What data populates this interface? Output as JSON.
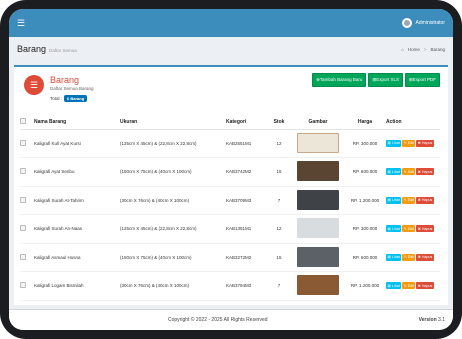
{
  "topbar": {
    "menu_icon": "☰",
    "user_name": "Administrator"
  },
  "header": {
    "title": "Barang",
    "subtitle": "Daftar Semua",
    "breadcrumb": {
      "home_icon": "⌂",
      "home": "Home",
      "sep": ">",
      "current": "Barang"
    }
  },
  "box": {
    "icon": "☰",
    "title": "Barang",
    "subtitle": "Daftar Semua Barang",
    "total_label": "Total :",
    "total_badge": "6 Barang",
    "buttons": {
      "add": "⊕Tambah Barang Baru",
      "export_xls": "⊞Export XLS",
      "export_pdf": "⊞Export PDF"
    }
  },
  "table": {
    "headers": {
      "nama": "Nama Barang",
      "ukuran": "Ukuran",
      "kategori": "Kategori",
      "stok": "Stok",
      "gambar": "Gambar",
      "harga": "Harga",
      "aksi": "Action"
    },
    "action_labels": {
      "lihat": "▤ Lihat",
      "edit": "✎ Edit",
      "hapus": "✖ Hapus"
    },
    "rows": [
      {
        "nama": "Kaligrafi Kufi Ayat Kursi",
        "ukuran": "(125cm X 45cm) & (22,8cm X 22,8cm)",
        "kategori": "KAB2551M1",
        "stok": "12",
        "harga": "RP. 300.000"
      },
      {
        "nama": "Kaligrafi Ayat Seribu",
        "ukuran": "(150cm X 75cm) & (40cm X 100cm)",
        "kategori": "KAB3742M2",
        "stok": "15",
        "harga": "RP. 600.000"
      },
      {
        "nama": "Kaligrafi Surah At-Tahrim",
        "ukuran": "(30cm X 76cm) & (40cm X 100cm)",
        "kategori": "KAB3709M3",
        "stok": "7",
        "harga": "RP. 1.200.000"
      },
      {
        "nama": "Kaligrafi Surah An-Naas",
        "ukuran": "(125cm X 45cm) & (22,8cm X 22,8cm)",
        "kategori": "KAB1351M1",
        "stok": "12",
        "harga": "RP. 300.000"
      },
      {
        "nama": "Kaligrafi Asmaul Husna",
        "ukuran": "(150cm X 75cm) & (40cm X 100cm)",
        "kategori": "KAB3272M2",
        "stok": "15",
        "harga": "RP. 600.000"
      },
      {
        "nama": "Kaligrafi Logam Bismilah",
        "ukuran": "(30cm X 76cm) & (40cm X 100cm)",
        "kategori": "KAB3794M3",
        "stok": "7",
        "harga": "RP. 1.200.000"
      }
    ]
  },
  "footer": {
    "copyright": "Copyright © 2022 - 2025 All Rights Reserved",
    "version_label": "Version",
    "version_value": "3.1"
  }
}
